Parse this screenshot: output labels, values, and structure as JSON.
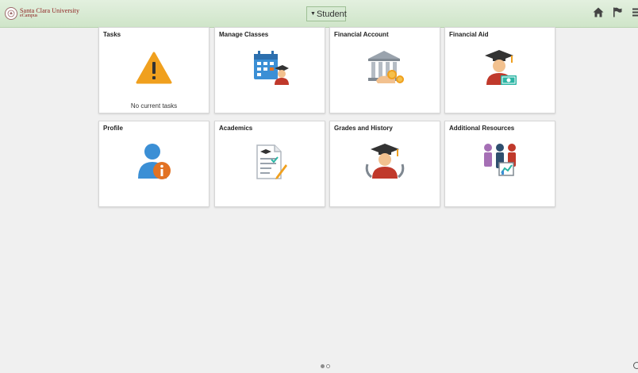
{
  "header": {
    "logo_main": "Santa Clara University",
    "logo_sub": "eCampus",
    "homepage_selector": "Student",
    "icons": [
      "home-icon",
      "flag-icon",
      "menu-icon"
    ]
  },
  "tiles": [
    {
      "title": "Tasks",
      "icon": "warning-icon",
      "note": "No current tasks"
    },
    {
      "title": "Manage Classes",
      "icon": "calendar-graduate-icon"
    },
    {
      "title": "Financial Account",
      "icon": "bank-coins-icon"
    },
    {
      "title": "Financial Aid",
      "icon": "graduate-money-icon"
    },
    {
      "title": "Profile",
      "icon": "person-info-icon"
    },
    {
      "title": "Academics",
      "icon": "document-pencil-icon"
    },
    {
      "title": "Grades and History",
      "icon": "graduate-laurel-icon"
    },
    {
      "title": "Additional Resources",
      "icon": "people-chart-icon"
    }
  ],
  "pagination": {
    "total_pages": 2,
    "current_page": 1
  },
  "colors": {
    "header": "#cfe5c9",
    "accent_orange": "#e27223",
    "accent_blue": "#3b8fd5",
    "accent_red": "#c0392b",
    "teal": "#2bb5a4",
    "warning": "#f0a01e"
  }
}
